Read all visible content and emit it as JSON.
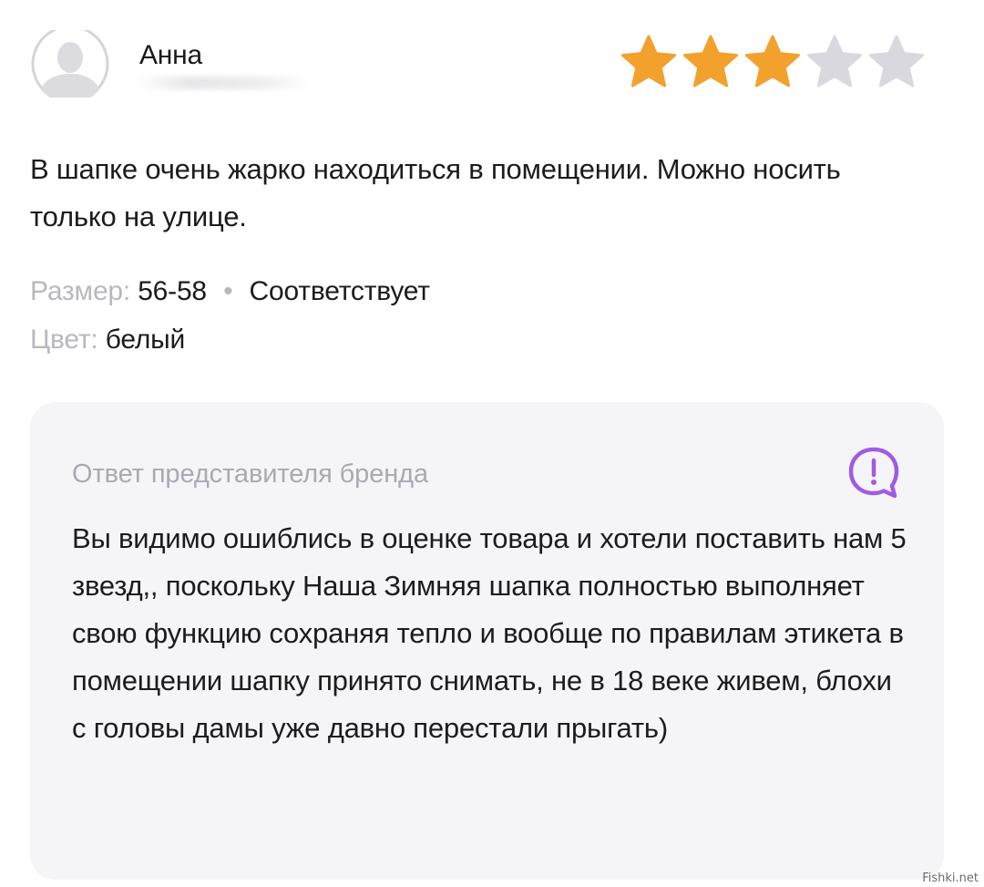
{
  "review": {
    "author": "Анна",
    "rating": 3,
    "rating_max": 5,
    "text": "В шапке очень жарко находиться в помещении. Можно носить только на улице.",
    "size_label": "Размер:",
    "size_value": "56-58",
    "size_separator": "•",
    "fit_value": "Соответствует",
    "color_label": "Цвет:",
    "color_value": "белый"
  },
  "brand_reply": {
    "title": "Ответ представителя бренда",
    "text": "Вы видимо ошиблись в оценке товара и хотели поставить нам 5 звезд,, поскольку Наша Зимняя шапка полностью выполняет свою функцию сохраняя тепло и вообще по правилам этикета в помещении шапку принято снимать, не в 18 веке живем, блохи с головы дамы уже давно перестали прыгать)"
  },
  "watermark": "Fishki.net",
  "icons": {
    "avatar": "user-avatar-icon",
    "star_filled": "star-filled-icon",
    "star_empty": "star-empty-icon",
    "brand": "speech-bubble-exclamation-icon"
  },
  "colors": {
    "star_filled": "#f2a12c",
    "star_empty": "#d8d8de",
    "brand_icon": "#a05ce0",
    "card_bg": "#f5f5f8",
    "muted_text": "#b8b8c0"
  }
}
